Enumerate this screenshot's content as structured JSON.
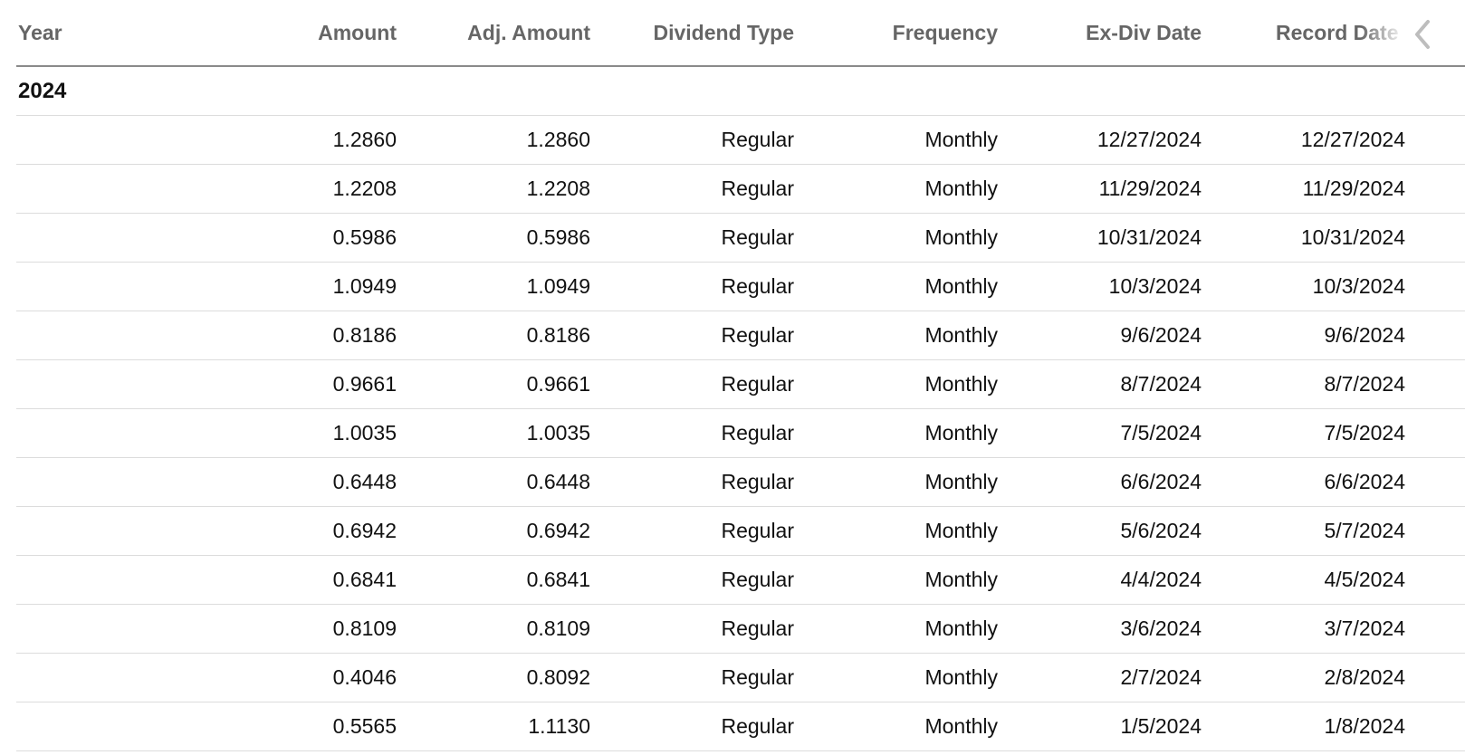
{
  "table": {
    "headers": {
      "year": "Year",
      "amount": "Amount",
      "adj_amount": "Adj. Amount",
      "dividend_type": "Dividend Type",
      "frequency": "Frequency",
      "ex_div_date": "Ex-Div Date",
      "record_date": "Record Date"
    },
    "scroll_icon": "chevron-left-icon",
    "group_label": "2024",
    "rows": [
      {
        "amount": "1.2860",
        "adj_amount": "1.2860",
        "type": "Regular",
        "frequency": "Monthly",
        "ex_div": "12/27/2024",
        "record": "12/27/2024"
      },
      {
        "amount": "1.2208",
        "adj_amount": "1.2208",
        "type": "Regular",
        "frequency": "Monthly",
        "ex_div": "11/29/2024",
        "record": "11/29/2024"
      },
      {
        "amount": "0.5986",
        "adj_amount": "0.5986",
        "type": "Regular",
        "frequency": "Monthly",
        "ex_div": "10/31/2024",
        "record": "10/31/2024"
      },
      {
        "amount": "1.0949",
        "adj_amount": "1.0949",
        "type": "Regular",
        "frequency": "Monthly",
        "ex_div": "10/3/2024",
        "record": "10/3/2024"
      },
      {
        "amount": "0.8186",
        "adj_amount": "0.8186",
        "type": "Regular",
        "frequency": "Monthly",
        "ex_div": "9/6/2024",
        "record": "9/6/2024"
      },
      {
        "amount": "0.9661",
        "adj_amount": "0.9661",
        "type": "Regular",
        "frequency": "Monthly",
        "ex_div": "8/7/2024",
        "record": "8/7/2024"
      },
      {
        "amount": "1.0035",
        "adj_amount": "1.0035",
        "type": "Regular",
        "frequency": "Monthly",
        "ex_div": "7/5/2024",
        "record": "7/5/2024"
      },
      {
        "amount": "0.6448",
        "adj_amount": "0.6448",
        "type": "Regular",
        "frequency": "Monthly",
        "ex_div": "6/6/2024",
        "record": "6/6/2024"
      },
      {
        "amount": "0.6942",
        "adj_amount": "0.6942",
        "type": "Regular",
        "frequency": "Monthly",
        "ex_div": "5/6/2024",
        "record": "5/7/2024"
      },
      {
        "amount": "0.6841",
        "adj_amount": "0.6841",
        "type": "Regular",
        "frequency": "Monthly",
        "ex_div": "4/4/2024",
        "record": "4/5/2024"
      },
      {
        "amount": "0.8109",
        "adj_amount": "0.8109",
        "type": "Regular",
        "frequency": "Monthly",
        "ex_div": "3/6/2024",
        "record": "3/7/2024"
      },
      {
        "amount": "0.4046",
        "adj_amount": "0.8092",
        "type": "Regular",
        "frequency": "Monthly",
        "ex_div": "2/7/2024",
        "record": "2/8/2024"
      },
      {
        "amount": "0.5565",
        "adj_amount": "1.1130",
        "type": "Regular",
        "frequency": "Monthly",
        "ex_div": "1/5/2024",
        "record": "1/8/2024"
      }
    ]
  },
  "colors": {
    "header_text": "#666666",
    "body_text": "#111111",
    "row_divider": "#dcdcdc",
    "header_divider": "#8a8a8a"
  }
}
